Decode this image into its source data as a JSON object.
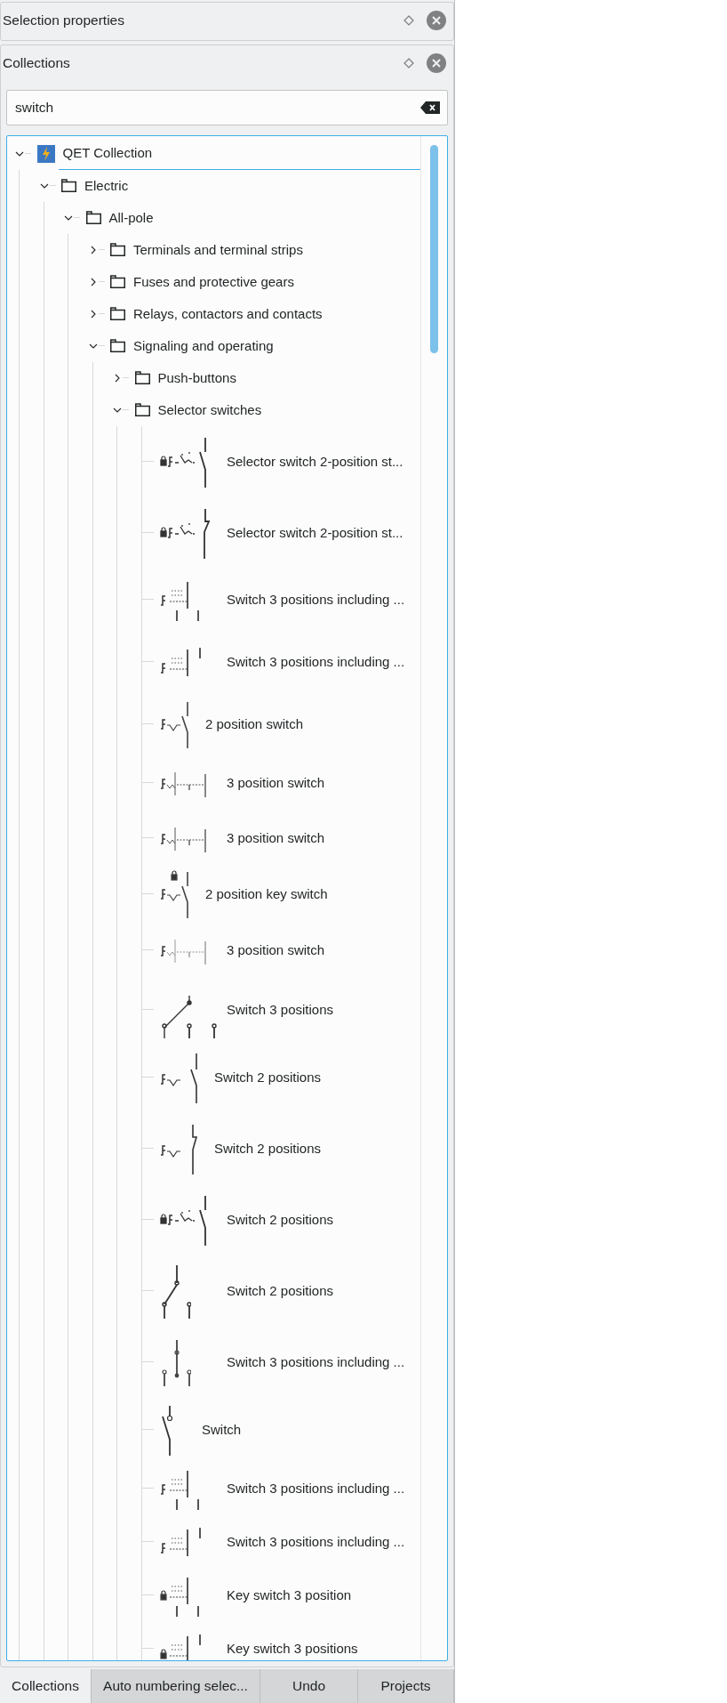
{
  "docks": [
    {
      "title": "Selection properties"
    },
    {
      "title": "Collections"
    }
  ],
  "search": {
    "value": "switch"
  },
  "tree": [
    {
      "label": "QET Collection",
      "kind": "collection",
      "expanded": true,
      "selected": true,
      "children": [
        {
          "label": "Electric",
          "kind": "folder",
          "expanded": true,
          "selected": false,
          "children": [
            {
              "label": "All-pole",
              "kind": "folder",
              "expanded": true,
              "selected": false,
              "children": [
                {
                  "label": "Terminals and terminal strips",
                  "kind": "folder",
                  "expanded": false,
                  "selected": false
                },
                {
                  "label": "Fuses and protective gears",
                  "kind": "folder",
                  "expanded": false,
                  "selected": false
                },
                {
                  "label": "Relays, contactors and contacts",
                  "kind": "folder",
                  "expanded": false,
                  "selected": false
                },
                {
                  "label": "Signaling and operating",
                  "kind": "folder",
                  "expanded": true,
                  "selected": false,
                  "children": [
                    {
                      "label": "Push-buttons",
                      "kind": "folder",
                      "expanded": false,
                      "selected": false
                    },
                    {
                      "label": "Selector switches",
                      "kind": "folder",
                      "expanded": true,
                      "selected": false,
                      "children": [
                        {
                          "label": "Selector switch 2-position st...",
                          "kind": "selkey",
                          "selected": false
                        },
                        {
                          "label": "Selector switch 2-position st...",
                          "kind": "selkeync",
                          "selected": false
                        },
                        {
                          "label": "Switch 3 positions including ...",
                          "kind": "cam3",
                          "selected": false
                        },
                        {
                          "label": "Switch 3 positions including ...",
                          "kind": "cam3nc",
                          "selected": false
                        },
                        {
                          "label": "2 position switch",
                          "kind": "twopos",
                          "selected": false
                        },
                        {
                          "label": "3 position  switch",
                          "kind": "threepos",
                          "selected": false
                        },
                        {
                          "label": "3 position  switch",
                          "kind": "threepos",
                          "selected": false
                        },
                        {
                          "label": "2 position key switch",
                          "kind": "keytwopos",
                          "selected": false
                        },
                        {
                          "label": "3 position  switch",
                          "kind": "threeposfaint",
                          "selected": false
                        },
                        {
                          "label": "Switch 3 positions",
                          "kind": "lever3",
                          "selected": false
                        },
                        {
                          "label": "Switch 2 positions",
                          "kind": "switch2",
                          "selected": false
                        },
                        {
                          "label": "Switch 2 positions",
                          "kind": "switch2nc",
                          "selected": false
                        },
                        {
                          "label": "Switch 2 positions",
                          "kind": "selkey",
                          "selected": false
                        },
                        {
                          "label": "Switch 2 positions",
                          "kind": "lever2",
                          "selected": false
                        },
                        {
                          "label": "Switch 3 positions including ...",
                          "kind": "push3",
                          "selected": false
                        },
                        {
                          "label": "Switch",
                          "kind": "simple",
                          "selected": false
                        },
                        {
                          "label": "Switch 3 positions including ...",
                          "kind": "cam3small",
                          "selected": false
                        },
                        {
                          "label": "Switch 3 positions including ...",
                          "kind": "cam3smallnc",
                          "selected": false
                        },
                        {
                          "label": "Key switch 3 position",
                          "kind": "key3",
                          "selected": false
                        },
                        {
                          "label": "Key switch 3 positions",
                          "kind": "key3nc",
                          "selected": false
                        }
                      ]
                    }
                  ]
                }
              ]
            }
          ]
        }
      ]
    }
  ],
  "tabs": [
    {
      "label": "Collections",
      "selected": true
    },
    {
      "label": "Auto numbering selec...",
      "selected": false
    },
    {
      "label": "Undo",
      "selected": false
    },
    {
      "label": "Projects",
      "selected": false
    }
  ]
}
